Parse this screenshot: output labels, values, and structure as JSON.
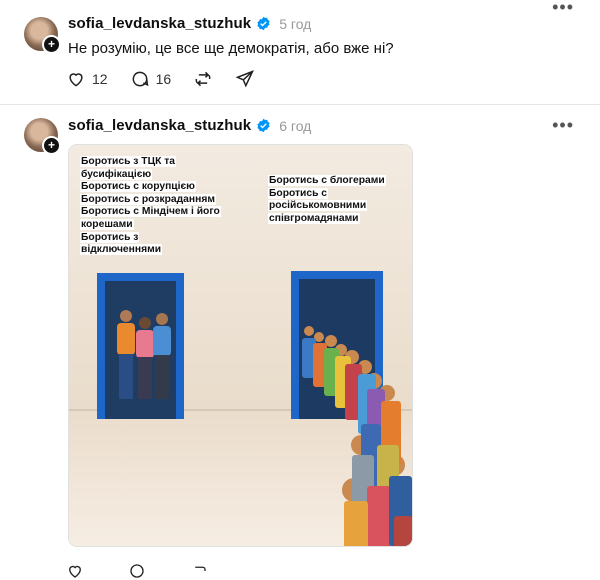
{
  "posts": [
    {
      "username": "sofia_levdanska_stuzhuk",
      "time": "5 год",
      "text": "Не розумію, це все ще демократія, або вже ні?",
      "likes": "12",
      "comments": "16"
    },
    {
      "username": "sofia_levdanska_stuzhuk",
      "time": "6 год",
      "image": {
        "left_caption": [
          "Боротись з ТЦК та",
          "бусифікацією",
          "Боротись с корупцією",
          "Боротись с розкраданням",
          "Боротись с Міндічем і його",
          "корешами",
          "Боротись з",
          "відключеннями"
        ],
        "right_caption": [
          "Боротись с блогерами",
          "Боротись с",
          "російськомовними",
          "співгромадянами"
        ]
      }
    }
  ],
  "icons": {
    "verified": "verified-badge-icon",
    "more": "more-options-icon",
    "like": "heart-icon",
    "comment": "comment-icon",
    "repost": "repost-icon",
    "share": "share-icon"
  },
  "colors": {
    "verified": "#0095f6",
    "door_frame": "#1f66c9",
    "wall": "#efe4d6",
    "floor": "#f2e6d8"
  }
}
